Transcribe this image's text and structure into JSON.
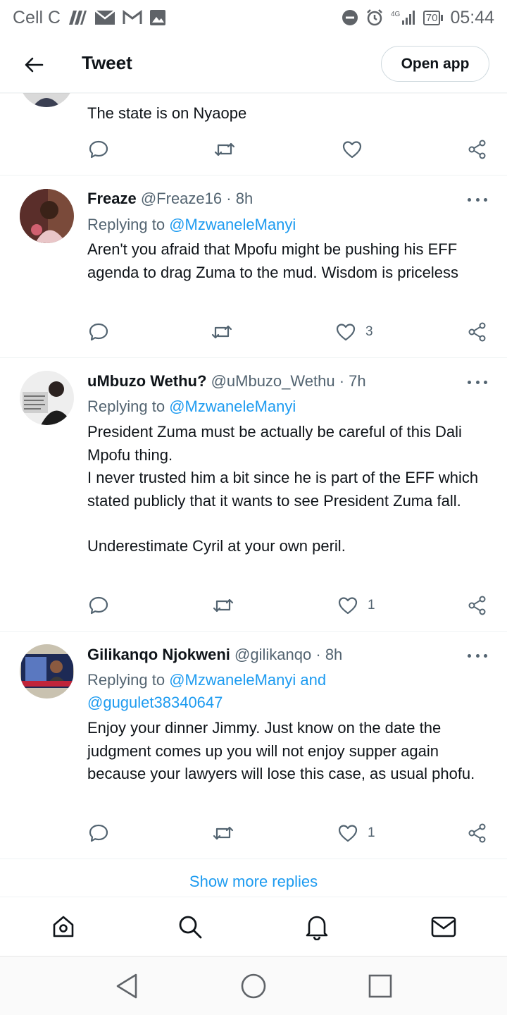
{
  "status_bar": {
    "carrier": "Cell C",
    "network": "4G",
    "battery": "70",
    "time": "05:44"
  },
  "header": {
    "title": "Tweet",
    "open_app_label": "Open app"
  },
  "partial_tweet": {
    "text": "The state is on Nyaope"
  },
  "tweets": [
    {
      "name": "Freaze",
      "handle": "@Freaze16",
      "dot": "·",
      "time": "8h",
      "replying_prefix": "Replying to ",
      "mentions": "@MzwaneleManyi",
      "mentions_2": "",
      "body": [
        "Aren't you afraid that Mpofu might be pushing his EFF agenda to drag Zuma to the mud. Wisdom is priceless"
      ],
      "likes": "3"
    },
    {
      "name": "uMbuzo Wethu?",
      "handle": "@uMbuzo_Wethu",
      "dot": "·",
      "time": "7h",
      "replying_prefix": "Replying to ",
      "mentions": "@MzwaneleManyi",
      "mentions_2": "",
      "body": [
        "President Zuma must be actually be careful of this Dali Mpofu thing.",
        "I never trusted him a bit since he is part of the EFF which stated publicly that it wants to see President Zuma fall.",
        "",
        "Underestimate Cyril at your own peril."
      ],
      "likes": "1"
    },
    {
      "name": "Gilikanqo Njokweni",
      "handle": "@gilikanqo",
      "dot": "·",
      "time": "8h",
      "replying_prefix": "Replying to ",
      "mentions": "@MzwaneleManyi and",
      "mentions_2": "@gugulet38340647",
      "body": [
        "Enjoy your dinner Jimmy. Just know on the date the judgment comes up you will not enjoy supper again because your lawyers will lose this case, as usual phofu."
      ],
      "likes": "1"
    }
  ],
  "show_more_label": "Show more replies",
  "colors": {
    "accent": "#1d9bf0",
    "text": "#0f1419",
    "muted": "#536471",
    "border": "#eff3f4"
  },
  "icons": [
    "back-arrow-icon",
    "reply-icon",
    "retweet-icon",
    "heart-icon",
    "share-icon",
    "more-icon",
    "home-icon",
    "search-icon",
    "notifications-icon",
    "messages-icon",
    "nav-back-icon",
    "nav-home-icon",
    "nav-recents-icon"
  ]
}
